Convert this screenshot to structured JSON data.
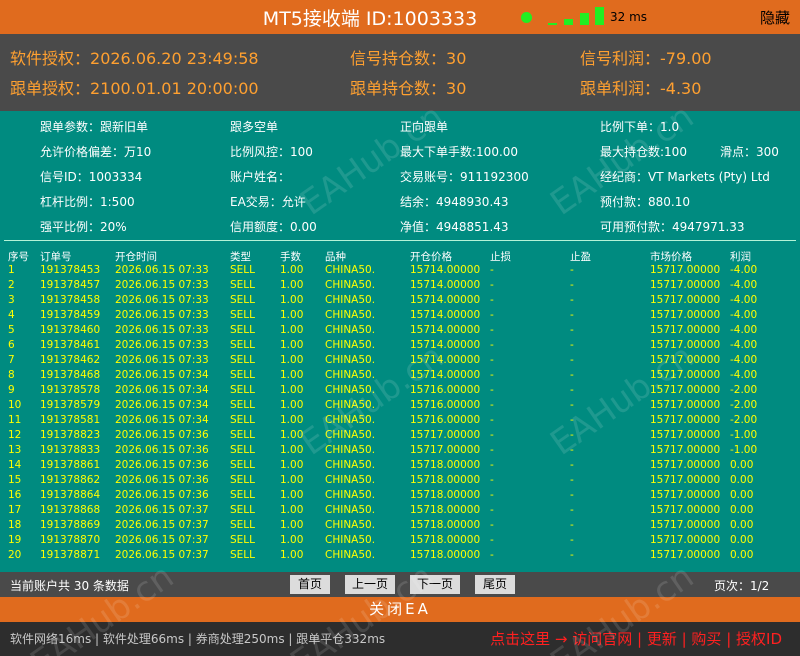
{
  "titlebar": {
    "title": "MT5接收端 ID:1003333",
    "ping": "32 ms",
    "hide_label": "隐藏",
    "status_color": "#22ee22"
  },
  "info": {
    "license_label": "软件授权：",
    "license_value": "2026.06.20 23:49:58",
    "follow_license_label": "跟单授权：",
    "follow_license_value": "2100.01.01 20:00:00",
    "signal_positions_label": "信号持仓数：",
    "signal_positions_value": "30",
    "follow_positions_label": "跟单持仓数：",
    "follow_positions_value": "30",
    "signal_profit_label": "信号利润：",
    "signal_profit_value": "-79.00",
    "follow_profit_label": "跟单利润：",
    "follow_profit_value": "-4.30"
  },
  "params": {
    "follow_param": "跟单参数：跟新旧单",
    "follow_long_short": "跟多空单",
    "direction": "正向跟单",
    "ratio_order": "比例下单：1.0",
    "price_dev": "允许价格偏差：万10",
    "ratio_risk": "比例风控：100",
    "max_lots": "最大下单手数:100.00",
    "max_positions": "最大持仓数:100",
    "slippage": "滑点：300",
    "signal_id": "信号ID：1003334",
    "account_name": "账户姓名：",
    "trade_account": "交易账号：911192300",
    "broker": "经纪商：VT Markets (Pty) Ltd",
    "leverage": "杠杆比例：1:500",
    "ea_trading": "EA交易：允许",
    "balance": "结余：4948930.43",
    "prepaid": "预付款：880.10",
    "stopout": "强平比例：20%",
    "credit": "信用额度：0.00",
    "equity": "净值：4948851.43",
    "free_margin": "可用预付款：4947971.33"
  },
  "table": {
    "headers": [
      "序号",
      "订单号",
      "开仓时间",
      "类型",
      "手数",
      "品种",
      "开仓价格",
      "止损",
      "止盈",
      "市场价格",
      "利润"
    ],
    "rows": [
      [
        "1",
        "191378453",
        "2026.06.15 07:33",
        "SELL",
        "1.00",
        "CHINA50.",
        "15714.00000",
        "-",
        "-",
        "15717.00000",
        "-4.00"
      ],
      [
        "2",
        "191378457",
        "2026.06.15 07:33",
        "SELL",
        "1.00",
        "CHINA50.",
        "15714.00000",
        "-",
        "-",
        "15717.00000",
        "-4.00"
      ],
      [
        "3",
        "191378458",
        "2026.06.15 07:33",
        "SELL",
        "1.00",
        "CHINA50.",
        "15714.00000",
        "-",
        "-",
        "15717.00000",
        "-4.00"
      ],
      [
        "4",
        "191378459",
        "2026.06.15 07:33",
        "SELL",
        "1.00",
        "CHINA50.",
        "15714.00000",
        "-",
        "-",
        "15717.00000",
        "-4.00"
      ],
      [
        "5",
        "191378460",
        "2026.06.15 07:33",
        "SELL",
        "1.00",
        "CHINA50.",
        "15714.00000",
        "-",
        "-",
        "15717.00000",
        "-4.00"
      ],
      [
        "6",
        "191378461",
        "2026.06.15 07:33",
        "SELL",
        "1.00",
        "CHINA50.",
        "15714.00000",
        "-",
        "-",
        "15717.00000",
        "-4.00"
      ],
      [
        "7",
        "191378462",
        "2026.06.15 07:33",
        "SELL",
        "1.00",
        "CHINA50.",
        "15714.00000",
        "-",
        "-",
        "15717.00000",
        "-4.00"
      ],
      [
        "8",
        "191378468",
        "2026.06.15 07:34",
        "SELL",
        "1.00",
        "CHINA50.",
        "15714.00000",
        "-",
        "-",
        "15717.00000",
        "-4.00"
      ],
      [
        "9",
        "191378578",
        "2026.06.15 07:34",
        "SELL",
        "1.00",
        "CHINA50.",
        "15716.00000",
        "-",
        "-",
        "15717.00000",
        "-2.00"
      ],
      [
        "10",
        "191378579",
        "2026.06.15 07:34",
        "SELL",
        "1.00",
        "CHINA50.",
        "15716.00000",
        "-",
        "-",
        "15717.00000",
        "-2.00"
      ],
      [
        "11",
        "191378581",
        "2026.06.15 07:34",
        "SELL",
        "1.00",
        "CHINA50.",
        "15716.00000",
        "-",
        "-",
        "15717.00000",
        "-2.00"
      ],
      [
        "12",
        "191378823",
        "2026.06.15 07:36",
        "SELL",
        "1.00",
        "CHINA50.",
        "15717.00000",
        "-",
        "-",
        "15717.00000",
        "-1.00"
      ],
      [
        "13",
        "191378833",
        "2026.06.15 07:36",
        "SELL",
        "1.00",
        "CHINA50.",
        "15717.00000",
        "-",
        "-",
        "15717.00000",
        "-1.00"
      ],
      [
        "14",
        "191378861",
        "2026.06.15 07:36",
        "SELL",
        "1.00",
        "CHINA50.",
        "15718.00000",
        "-",
        "-",
        "15717.00000",
        "0.00"
      ],
      [
        "15",
        "191378862",
        "2026.06.15 07:36",
        "SELL",
        "1.00",
        "CHINA50.",
        "15718.00000",
        "-",
        "-",
        "15717.00000",
        "0.00"
      ],
      [
        "16",
        "191378864",
        "2026.06.15 07:36",
        "SELL",
        "1.00",
        "CHINA50.",
        "15718.00000",
        "-",
        "-",
        "15717.00000",
        "0.00"
      ],
      [
        "17",
        "191378868",
        "2026.06.15 07:37",
        "SELL",
        "1.00",
        "CHINA50.",
        "15718.00000",
        "-",
        "-",
        "15717.00000",
        "0.00"
      ],
      [
        "18",
        "191378869",
        "2026.06.15 07:37",
        "SELL",
        "1.00",
        "CHINA50.",
        "15718.00000",
        "-",
        "-",
        "15717.00000",
        "0.00"
      ],
      [
        "19",
        "191378870",
        "2026.06.15 07:37",
        "SELL",
        "1.00",
        "CHINA50.",
        "15718.00000",
        "-",
        "-",
        "15717.00000",
        "0.00"
      ],
      [
        "20",
        "191378871",
        "2026.06.15 07:37",
        "SELL",
        "1.00",
        "CHINA50.",
        "15718.00000",
        "-",
        "-",
        "15717.00000",
        "0.00"
      ]
    ]
  },
  "pager": {
    "count_text": "当前账户共 30 条数据",
    "first": "首页",
    "prev": "上一页",
    "next": "下一页",
    "last": "尾页",
    "page_info": "页次：1/2"
  },
  "close_label": "关闭EA",
  "status": {
    "stats": "软件网络16ms | 软件处理66ms | 券商处理250ms | 跟单平仓332ms",
    "links": "点击这里 → 访问官网 | 更新 | 购买 | 授权ID"
  },
  "watermark": "EAHub.cn",
  "colors": {
    "accent_orange": "#e06b1e",
    "panel_gray": "#4a4a4a",
    "body_teal": "#008b80",
    "table_text": "#ffff00",
    "info_text": "#ffa030",
    "link_red": "#ff2020"
  }
}
